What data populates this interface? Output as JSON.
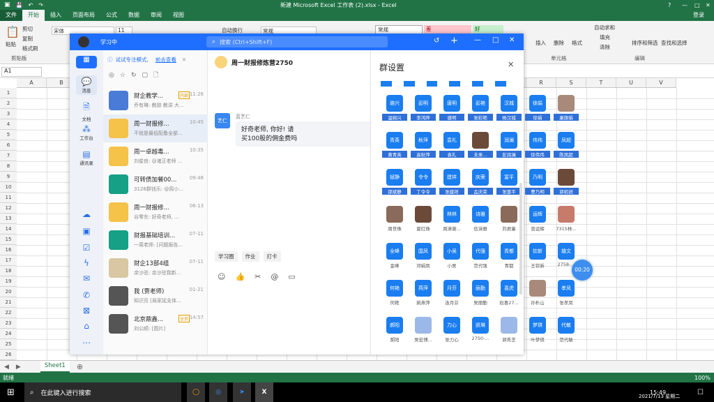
{
  "excel": {
    "title": "新建 Microsoft Excel 工作表 (2).xlsx - Excel",
    "login": "登录",
    "tabs": [
      "文件",
      "开始",
      "插入",
      "页面布局",
      "公式",
      "数据",
      "审阅",
      "视图"
    ],
    "ribbon": {
      "paste": "粘贴",
      "cut": "剪切",
      "copy": "复制",
      "painter": "格式刷",
      "clipboard": "剪贴板",
      "font": "宋体",
      "size": "11",
      "wrap": "自动换行",
      "numfmt": "常规",
      "style_normal": "常规",
      "style_bad": "差",
      "style_good": "好",
      "autosum": "自动求和",
      "fill": "填充",
      "clear": "清除",
      "insert": "插入",
      "delete": "删除",
      "format": "格式",
      "cells": "单元格",
      "sortfilter": "排序和筛选",
      "findselect": "查找和选择",
      "editing": "编辑"
    },
    "namebox": "A1",
    "columns": [
      "A",
      "B",
      "C",
      "D",
      "E",
      "F",
      "G",
      "H",
      "I",
      "J",
      "K",
      "L",
      "M",
      "N",
      "O",
      "P",
      "Q",
      "R",
      "S",
      "T",
      "U",
      "V"
    ],
    "rows": [
      "1",
      "2",
      "3",
      "4",
      "5",
      "6",
      "7",
      "8",
      "9",
      "10",
      "11",
      "12",
      "13",
      "14",
      "15",
      "16",
      "17",
      "18",
      "19",
      "20",
      "21",
      "22",
      "23",
      "24",
      "25",
      "26"
    ],
    "sheet": "Sheet1",
    "status": "就绪",
    "zoom": "100%"
  },
  "taskbar": {
    "search": "在此键入进行搜索",
    "time": "15:49",
    "date": "2021/7/13 星期二"
  },
  "app": {
    "status": "学习中",
    "search_placeholder": "搜索 (Ctrl+Shift+F)",
    "chat_title": "周一财报修炼营2750",
    "focus_tip": "试试专注模式,",
    "focus_link": "前去查看",
    "rail": [
      "消息",
      "文档",
      "工作台",
      "通讯录"
    ],
    "conversations": [
      {
        "name": "财企教学...",
        "tag": "内部",
        "time": "11:26",
        "preview": "乔有琳: 教辞 教讲 大..."
      },
      {
        "name": "周一财报修...",
        "tag": "",
        "time": "10:45",
        "preview": "不就是最低配备全部..."
      },
      {
        "name": "周一卓越毒...",
        "tag": "",
        "time": "10:35",
        "preview": "刘俊良: @诸正老师 ..."
      },
      {
        "name": "可转债加餐00...",
        "tag": "",
        "time": "09:48",
        "preview": "3126群钱乐: @周小..."
      },
      {
        "name": "周一财报修...",
        "tag": "",
        "time": "06:13",
        "preview": "谷零东: 好奇老师, ..."
      },
      {
        "name": "财报基础培训...",
        "tag": "",
        "time": "07-11",
        "preview": "一周老师: [问题报告..."
      },
      {
        "name": "财企13部4组",
        "tag": "",
        "time": "07-11",
        "preview": "余沙驻: 余沙驻我新..."
      },
      {
        "name": "我 (贾老师)",
        "tag": "",
        "time": "01-21",
        "preview": "知识页 [局家延支体..."
      },
      {
        "name": "北京鼎鑫...",
        "tag": "全员",
        "time": "14:57",
        "preview": "刘公顺: [图片]"
      }
    ],
    "message": {
      "sender": "蓝艺仁",
      "avatar": "艺仁",
      "text1": "好奇老师, 你好! 请",
      "text2": "买100股的佣金费吗"
    },
    "toolbar": [
      "学习圈",
      "作业",
      "打卡"
    ],
    "panel_title": "群设置",
    "members": [
      [
        [
          "骆兴",
          "温婉兴"
        ],
        [
          "彭明",
          "李鸿烨"
        ],
        [
          "唐明",
          "唐明"
        ],
        [
          "彭艳",
          "张彩艳"
        ],
        [
          "汉城",
          "杨汉城"
        ],
        [
          "徐娟",
          "徐娟"
        ],
        [
          "",
          "康旗娟"
        ]
      ],
      [
        [
          "青英",
          "黄青英"
        ],
        [
          "秋萍",
          "高秋萍"
        ],
        [
          "袁礼",
          "袁礼"
        ],
        [
          "",
          "未来..."
        ],
        [
          "润澜",
          "彭润澜"
        ],
        [
          "伟伟",
          "徐伟伟"
        ],
        [
          "凤超",
          "陈凤超"
        ]
      ],
      [
        [
          "斌静",
          "邵斌静"
        ],
        [
          "令令",
          "丁令令"
        ],
        [
          "建祥",
          "张建祥"
        ],
        [
          "庆荣",
          "孟庆荣"
        ],
        [
          "富平",
          "张富平"
        ],
        [
          "乃明",
          "曹乃明"
        ],
        [
          "",
          "郭机锐"
        ]
      ],
      [
        [
          "",
          "周世珠"
        ],
        [
          "",
          "夏红珠"
        ],
        [
          "林林",
          "周淋谢..."
        ],
        [
          "诗雅",
          "伍诗雅"
        ],
        [
          "",
          "刘君童"
        ],
        [
          "运辉",
          "曾运辉"
        ],
        [
          "",
          "7315林..."
        ]
      ],
      [
        [
          "全峰",
          "金峰"
        ],
        [
          "国凤",
          "邓娟凤"
        ],
        [
          "小吴",
          "小吴"
        ],
        [
          "代强",
          "范代强"
        ],
        [
          "青都",
          "青都"
        ],
        [
          "钦新",
          "王钦新"
        ],
        [
          "雄文",
          "2758-..."
        ]
      ],
      [
        [
          "何艳",
          "何艳"
        ],
        [
          "燕萍",
          "姚燕萍"
        ],
        [
          "月芬",
          "连月芬"
        ],
        [
          "丽勤",
          "吴丽勤"
        ],
        [
          "喜虎",
          "段喜27..."
        ],
        [
          "",
          "孙朴山"
        ],
        [
          "孝凤",
          "张孝凤"
        ]
      ],
      [
        [
          "郝阳",
          "郝阳"
        ],
        [
          "",
          "吴宏博..."
        ],
        [
          "力心",
          "张力心"
        ],
        [
          "凯琳",
          "2750-..."
        ],
        [
          "",
          "郭秀芝"
        ],
        [
          "梦琪",
          "叶梦琪"
        ],
        [
          "代敏",
          "范代敏"
        ]
      ]
    ],
    "timer": "00:20"
  }
}
